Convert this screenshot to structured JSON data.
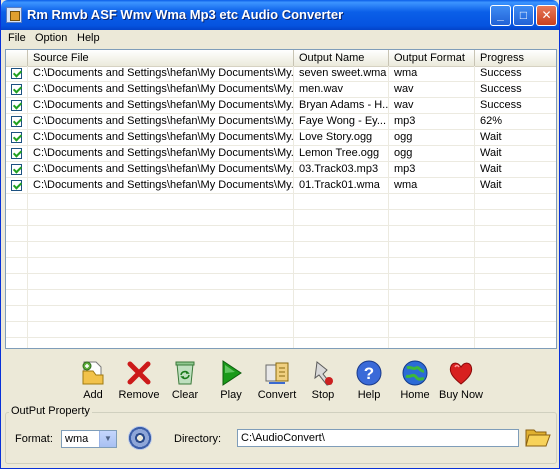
{
  "window": {
    "title": "Rm Rmvb ASF Wmv Wma Mp3 etc Audio Converter"
  },
  "menu": [
    "File",
    "Option",
    "Help"
  ],
  "columns": [
    "Source File",
    "Output Name",
    "Output Format",
    "Progress"
  ],
  "rows": [
    {
      "source": "C:\\Documents and Settings\\hefan\\My Documents\\My...",
      "output_name": "seven sweet.wma",
      "format": "wma",
      "progress": "Success"
    },
    {
      "source": "C:\\Documents and Settings\\hefan\\My Documents\\My...",
      "output_name": "men.wav",
      "format": "wav",
      "progress": "Success"
    },
    {
      "source": "C:\\Documents and Settings\\hefan\\My Documents\\My...",
      "output_name": "Bryan Adams - H...",
      "format": "wav",
      "progress": "Success"
    },
    {
      "source": "C:\\Documents and Settings\\hefan\\My Documents\\My...",
      "output_name": "Faye Wong - Ey...",
      "format": "mp3",
      "progress": "62%"
    },
    {
      "source": "C:\\Documents and Settings\\hefan\\My Documents\\My...",
      "output_name": "Love Story.ogg",
      "format": "ogg",
      "progress": "Wait"
    },
    {
      "source": "C:\\Documents and Settings\\hefan\\My Documents\\My...",
      "output_name": "Lemon Tree.ogg",
      "format": "ogg",
      "progress": "Wait"
    },
    {
      "source": "C:\\Documents and Settings\\hefan\\My Documents\\My...",
      "output_name": "03.Track03.mp3",
      "format": "mp3",
      "progress": "Wait"
    },
    {
      "source": "C:\\Documents and Settings\\hefan\\My Documents\\My...",
      "output_name": "01.Track01.wma",
      "format": "wma",
      "progress": "Wait"
    }
  ],
  "toolbar": {
    "add": "Add",
    "remove": "Remove",
    "clear": "Clear",
    "play": "Play",
    "convert": "Convert",
    "stop": "Stop",
    "help": "Help",
    "home": "Home",
    "buy_now": "Buy Now"
  },
  "output_property": {
    "group_title": "OutPut Property",
    "format_label": "Format:",
    "format_value": "wma",
    "directory_label": "Directory:",
    "directory_value": "C:\\AudioConvert\\"
  },
  "icons": {
    "add": "add-file-icon",
    "remove": "remove-x-icon",
    "clear": "recycle-bin-icon",
    "play": "play-triangle-icon",
    "convert": "convert-icon",
    "stop": "stop-icon",
    "help": "help-question-icon",
    "home": "globe-home-icon",
    "buy_now": "heart-icon",
    "format_disc": "cd-disc-icon",
    "browse": "open-folder-icon"
  },
  "colors": {
    "title_bar": "#0553e0",
    "check": "#21a121",
    "remove_x": "#cc1a1a",
    "play_green": "#1a9a1a",
    "heart_red": "#d82020"
  }
}
